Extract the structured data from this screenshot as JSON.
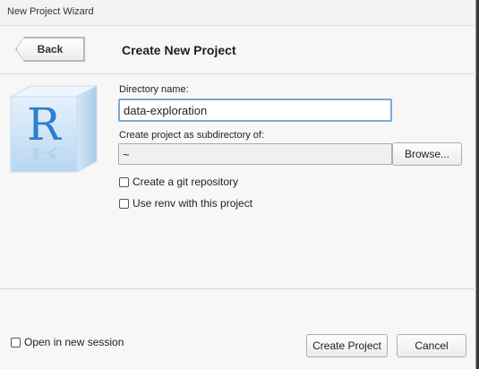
{
  "window": {
    "title": "New Project Wizard"
  },
  "header": {
    "back_label": "Back",
    "title": "Create New Project"
  },
  "form": {
    "directory_label": "Directory name:",
    "directory_value": "data-exploration",
    "subdirectory_label": "Create project as subdirectory of:",
    "subdirectory_value": "~",
    "browse_label": "Browse...",
    "git_label": "Create a git repository",
    "git_checked": false,
    "renv_label": "Use renv with this project",
    "renv_checked": false
  },
  "footer": {
    "new_session_label": "Open in new session",
    "new_session_checked": false,
    "create_label": "Create Project",
    "cancel_label": "Cancel"
  },
  "logo": {
    "letter": "R",
    "accent": "#2b7fcf"
  }
}
